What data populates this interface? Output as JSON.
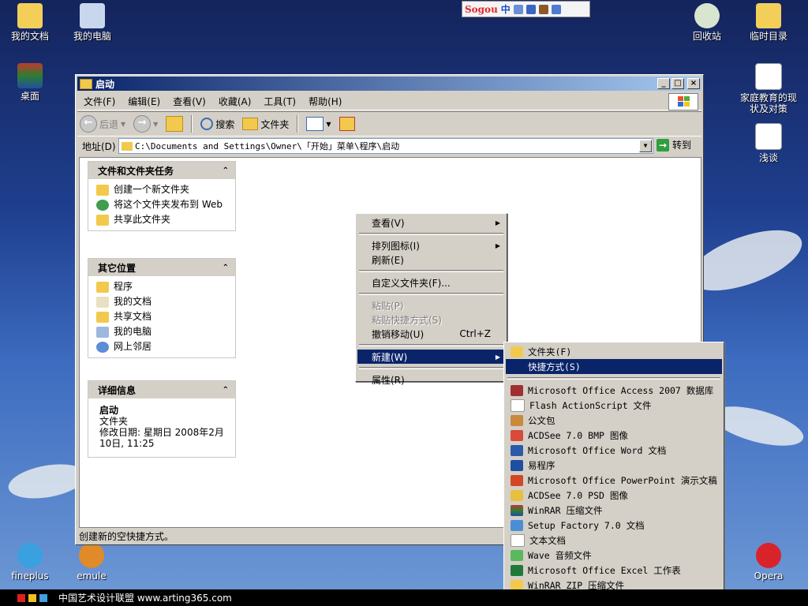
{
  "sogou": {
    "logo": "Sogou",
    "mode": "中"
  },
  "desktop_icons": [
    {
      "label": "我的文档",
      "icon": "my-documents-icon"
    },
    {
      "label": "我的电脑",
      "icon": "my-computer-icon"
    },
    {
      "label": "桌面",
      "icon": "winrar-icon"
    },
    {
      "label": "回收站",
      "icon": "recycle-bin-icon"
    },
    {
      "label": "临时目录",
      "icon": "folder-windows-icon"
    },
    {
      "label": "家庭教育的现状及对策",
      "icon": "document-icon"
    },
    {
      "label": "浅谈",
      "icon": "document-icon"
    },
    {
      "label": "fineplus",
      "icon": "fineplus-icon"
    },
    {
      "label": "emule",
      "icon": "emule-icon"
    },
    {
      "label": "Opera",
      "icon": "opera-icon"
    }
  ],
  "window": {
    "title": "启动",
    "menu": [
      "文件(F)",
      "编辑(E)",
      "查看(V)",
      "收藏(A)",
      "工具(T)",
      "帮助(H)"
    ],
    "toolbar": {
      "back": "后退",
      "search": "搜索",
      "folders": "文件夹"
    },
    "address": {
      "label": "地址(D)",
      "value": "C:\\Documents and Settings\\Owner\\「开始」菜单\\程序\\启动",
      "go": "转到"
    },
    "status": "创建新的空快捷方式。"
  },
  "panels": {
    "tasks": {
      "title": "文件和文件夹任务",
      "items": [
        "创建一个新文件夹",
        "将这个文件夹发布到 Web",
        "共享此文件夹"
      ]
    },
    "places": {
      "title": "其它位置",
      "items": [
        "程序",
        "我的文档",
        "共享文档",
        "我的电脑",
        "网上邻居"
      ]
    },
    "details": {
      "title": "详细信息",
      "name": "启动",
      "type": "文件夹",
      "modified": "修改日期: 星期日 2008年2月10日, 11:25"
    }
  },
  "context_menu": {
    "view": "查看(V)",
    "arrange": "排列图标(I)",
    "refresh": "刷新(E)",
    "customize": "自定义文件夹(F)...",
    "paste": "粘贴(P)",
    "paste_shortcut": "粘贴快捷方式(S)",
    "undo": "撤销移动(U)",
    "undo_shortcut": "Ctrl+Z",
    "new": "新建(W)",
    "properties": "属性(R)"
  },
  "new_submenu": {
    "folder": "文件夹(F)",
    "shortcut": "快捷方式(S)",
    "items": [
      "Microsoft Office Access 2007 数据库",
      "Flash ActionScript 文件",
      "公文包",
      "ACDSee 7.0 BMP 图像",
      "Microsoft Office Word 文档",
      "易程序",
      "Microsoft Office PowerPoint 演示文稿",
      "ACDSee 7.0 PSD 图像",
      "WinRAR 压缩文件",
      "Setup Factory 7.0 文档",
      "文本文档",
      "Wave 音频文件",
      "Microsoft Office Excel 工作表",
      "WinRAR ZIP 压缩文件"
    ]
  },
  "footer": {
    "text": "中国艺术设计联盟 www.arting365.com"
  }
}
